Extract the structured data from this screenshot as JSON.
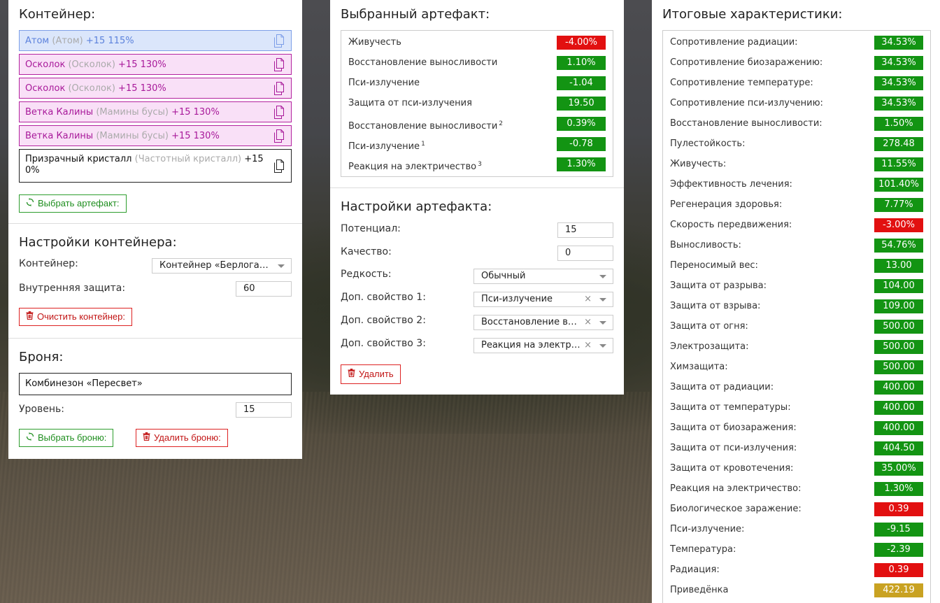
{
  "container": {
    "title": "Контейнер:",
    "artifacts": [
      {
        "name": "Атом",
        "sub": "(Атом)",
        "level": "+15 115%",
        "style": "blue"
      },
      {
        "name": "Осколок",
        "sub": "(Осколок)",
        "level": "+15 130%",
        "style": "pink"
      },
      {
        "name": "Осколок",
        "sub": "(Осколок)",
        "level": "+15 130%",
        "style": "pink"
      },
      {
        "name": "Ветка Калины",
        "sub": "(Мамины бусы)",
        "level": "+15 130%",
        "style": "pink"
      },
      {
        "name": "Ветка Калины",
        "sub": "(Мамины бусы)",
        "level": "+15 130%",
        "style": "pink"
      },
      {
        "name": "Призрачный кристалл",
        "sub": "(Частотный кристалл)",
        "level": "+15 0%",
        "style": "dark"
      }
    ],
    "select_button": "Выбрать артефакт:"
  },
  "container_settings": {
    "title": "Настройки контейнера:",
    "container_label": "Контейнер:",
    "container_value": "Контейнер «Берлога…",
    "protection_label": "Внутренняя защита:",
    "protection_value": "60",
    "clear_button": "Очистить контейнер:"
  },
  "armor": {
    "title": "Броня:",
    "name": "Комбинезон «Пересвет»",
    "level_label": "Уровень:",
    "level_value": "15",
    "select_button": "Выбрать броню:",
    "delete_button": "Удалить броню:"
  },
  "selected_artifact": {
    "title": "Выбранный артефакт:",
    "stats": [
      {
        "name": "Живучесть",
        "sup": "",
        "value": "-4.00%",
        "color": "red"
      },
      {
        "name": "Восстановление выносливости",
        "sup": "",
        "value": "1.10%",
        "color": "green"
      },
      {
        "name": "Пси-излучение",
        "sup": "",
        "value": "-1.04",
        "color": "green"
      },
      {
        "name": "Защита от пси-излучения",
        "sup": "",
        "value": "19.50",
        "color": "green"
      },
      {
        "name": "Восстановление выносливости",
        "sup": "2",
        "value": "0.39%",
        "color": "green"
      },
      {
        "name": "Пси-излучение",
        "sup": "1",
        "value": "-0.78",
        "color": "green"
      },
      {
        "name": "Реакция на электричество",
        "sup": "3",
        "value": "1.30%",
        "color": "green"
      }
    ]
  },
  "artifact_settings": {
    "title": "Настройки артефакта:",
    "potential_label": "Потенциал:",
    "potential_value": "15",
    "quality_label": "Качество:",
    "quality_value": "0",
    "rarity_label": "Редкость:",
    "rarity_value": "Обычный",
    "extra1_label": "Доп. свойство 1:",
    "extra1_value": "Пси-излучение",
    "extra2_label": "Доп. свойство 2:",
    "extra2_value": "Восстановление в…",
    "extra3_label": "Доп. свойство 3:",
    "extra3_value": "Реакция на электр…",
    "clear_symbol": "×",
    "delete_button": "Удалить"
  },
  "totals": {
    "title": "Итоговые характеристики:",
    "stats": [
      {
        "name": "Сопротивление радиации:",
        "value": "34.53%",
        "color": "green"
      },
      {
        "name": "Сопротивление биозаражению:",
        "value": "34.53%",
        "color": "green"
      },
      {
        "name": "Сопротивление температуре:",
        "value": "34.53%",
        "color": "green"
      },
      {
        "name": "Сопротивление пси-излучению:",
        "value": "34.53%",
        "color": "green"
      },
      {
        "name": "Восстановление выносливости:",
        "value": "1.50%",
        "color": "green"
      },
      {
        "name": "Пулестойкость:",
        "value": "278.48",
        "color": "green"
      },
      {
        "name": "Живучесть:",
        "value": "11.55%",
        "color": "green"
      },
      {
        "name": "Эффективность лечения:",
        "value": "101.40%",
        "color": "green"
      },
      {
        "name": "Регенерация здоровья:",
        "value": "7.77%",
        "color": "green"
      },
      {
        "name": "Скорость передвижения:",
        "value": "-3.00%",
        "color": "red"
      },
      {
        "name": "Выносливость:",
        "value": "54.76%",
        "color": "green"
      },
      {
        "name": "Переносимый вес:",
        "value": "13.00",
        "color": "green"
      },
      {
        "name": "Защита от разрыва:",
        "value": "104.00",
        "color": "green"
      },
      {
        "name": "Защита от взрыва:",
        "value": "109.00",
        "color": "green"
      },
      {
        "name": "Защита от огня:",
        "value": "500.00",
        "color": "green"
      },
      {
        "name": "Электрозащита:",
        "value": "500.00",
        "color": "green"
      },
      {
        "name": "Химзащита:",
        "value": "500.00",
        "color": "green"
      },
      {
        "name": "Защита от радиации:",
        "value": "400.00",
        "color": "green"
      },
      {
        "name": "Защита от температуры:",
        "value": "400.00",
        "color": "green"
      },
      {
        "name": "Защита от биозаражения:",
        "value": "400.00",
        "color": "green"
      },
      {
        "name": "Защита от пси-излучения:",
        "value": "404.50",
        "color": "green"
      },
      {
        "name": "Защита от кровотечения:",
        "value": "35.00%",
        "color": "green"
      },
      {
        "name": "Реакция на электричество:",
        "value": "1.30%",
        "color": "green"
      },
      {
        "name": "Биологическое заражение:",
        "value": "0.39",
        "color": "red"
      },
      {
        "name": "Пси-излучение:",
        "value": "-9.15",
        "color": "green"
      },
      {
        "name": "Температура:",
        "value": "-2.39",
        "color": "green"
      },
      {
        "name": "Радиация:",
        "value": "0.39",
        "color": "red"
      },
      {
        "name": "Приведёнка",
        "value": "422.19",
        "color": "gold"
      }
    ]
  },
  "icons": {
    "copy": "copy-icon",
    "refresh": "refresh-icon",
    "trash": "trash-icon"
  }
}
